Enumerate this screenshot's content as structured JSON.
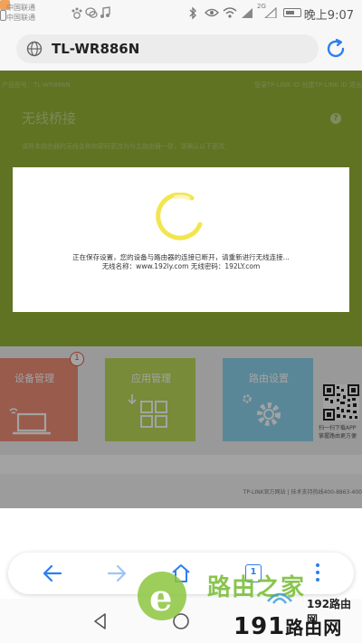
{
  "status_bar": {
    "carrier1": "中国联通",
    "carrier2": "中国联通",
    "network_label": "2G",
    "time": "晚上9:07"
  },
  "address_bar": {
    "url": "TL-WR886N",
    "icons": [
      "globe-icon",
      "refresh-icon"
    ]
  },
  "router_page": {
    "header_left": "产品型号：TL-WR886N",
    "header_right": "登录TP-LINK ID  创建TP-LINK ID  退出",
    "heading": "无线桥接",
    "description": "请将本路由器的无线名称和密码更改为与主路由器一致，请确认以下更改：",
    "tiles": [
      {
        "label": "设备管理",
        "color": "#f08f77"
      },
      {
        "label": "应用管理",
        "color": "#bbda5a"
      },
      {
        "label": "路由设置",
        "color": "#8dd4ec"
      }
    ],
    "device_badge": "1",
    "qr_caption_1": "扫一扫下载APP",
    "qr_caption_2": "掌握路由更方便",
    "footer": "TP-LINK官方网站  |  技术支持热线400-8863-400"
  },
  "modal": {
    "line1": "正在保存设置，您的设备与路由器的连接已断开，请重新进行无线连接...",
    "line2": "无线名称：www.192ly.com 无线密码：192LY.com"
  },
  "toolbar": {
    "tabs_count": "1",
    "icons": [
      "back-icon",
      "forward-icon",
      "home-icon",
      "tabs-icon",
      "menu-icon"
    ]
  },
  "watermark": {
    "text1": "路由之家",
    "text2": "192路由网",
    "text3_a": "191",
    "text3_b": "路由网"
  },
  "colors": {
    "accent": "#2d7ef0",
    "router_green": "#95b437",
    "spinner": "#f2e23c"
  }
}
